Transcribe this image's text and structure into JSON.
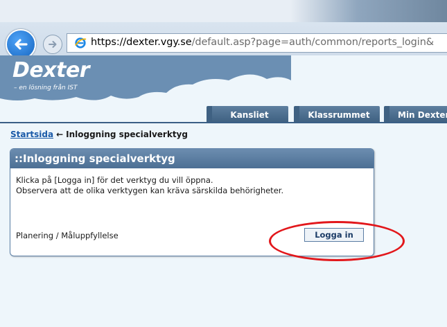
{
  "browser": {
    "url_prefix": "https://dexter.",
    "url_domain": "vgy.se",
    "url_path": "/default.asp?page=auth/common/reports_login&"
  },
  "brand": {
    "title": "Dexter",
    "subtitle": "– en lösning från IST"
  },
  "nav_tabs": [
    {
      "label": "Kansliet"
    },
    {
      "label": "Klassrummet"
    },
    {
      "label": "Min Dexter"
    }
  ],
  "breadcrumb": {
    "home": "Startsida",
    "current": "Inloggning specialverktyg"
  },
  "panel": {
    "title": "::Inloggning specialverktyg",
    "line1": "Klicka på [Logga in] för det verktyg du vill öppna.",
    "line2": "Observera att de olika verktygen kan kräva särskilda behörigheter.",
    "tool_name": "Planering / Måluppfyllelse",
    "login_label": "Logga in"
  },
  "colors": {
    "accent": "#4c6f94",
    "highlight": "#e2171b"
  }
}
